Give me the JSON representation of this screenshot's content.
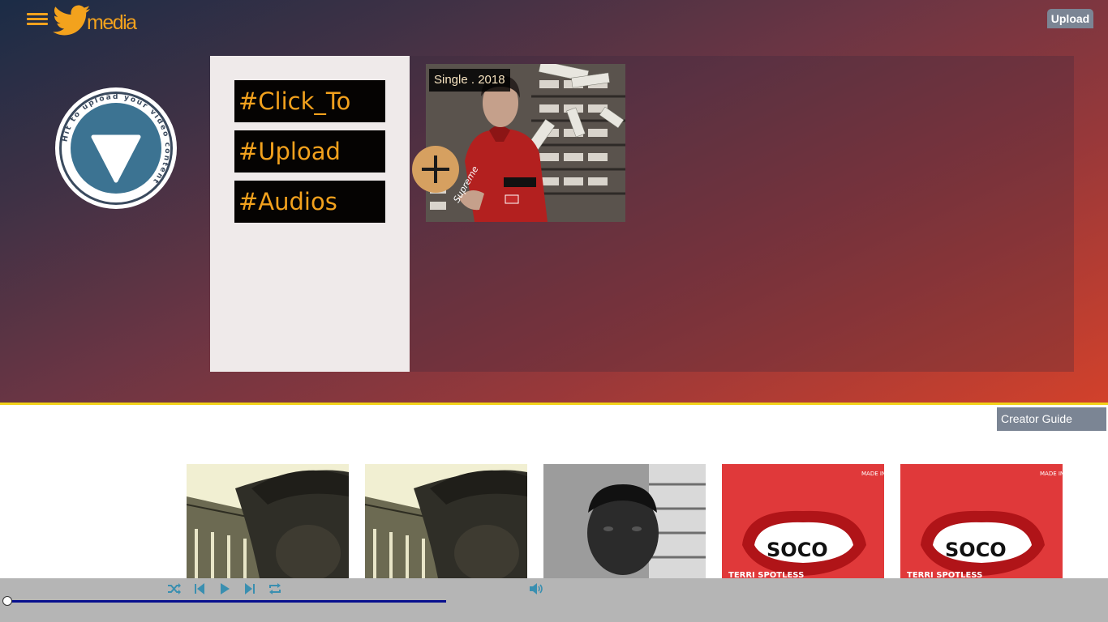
{
  "header": {
    "logo_text": "media",
    "upload_label": "Upload"
  },
  "upload_badge": {
    "ring_text": "Hit to upload your video content"
  },
  "hashtags": [
    "#Click_To",
    "#Upload",
    "#Audios"
  ],
  "featured": {
    "label": "Single . 2018",
    "art_text": "Supreme"
  },
  "creator_guide_label": "Creator Guide",
  "thumbnails": [
    {
      "kind": "portrait-cap"
    },
    {
      "kind": "portrait-cap"
    },
    {
      "kind": "portrait-bw"
    },
    {
      "kind": "soco-cover",
      "title": "SOCO",
      "artist": "TERRI SPOTLESS",
      "badge": "MADE IN LAGOS"
    },
    {
      "kind": "soco-cover",
      "title": "SOCO",
      "artist": "TERRI SPOTLESS",
      "badge": "MADE IN LAGOS"
    }
  ],
  "player": {
    "icons": [
      "shuffle-icon",
      "previous-icon",
      "play-icon",
      "next-icon",
      "repeat-icon",
      "volume-icon"
    ],
    "progress": 0.0
  },
  "colors": {
    "accent": "#f3a21d",
    "hero_border": "#f2d21a",
    "button_gray": "#7b8594",
    "player_bar": "#b5b5b5",
    "progress": "#070f8e",
    "player_icons": "#3a8fb0"
  }
}
